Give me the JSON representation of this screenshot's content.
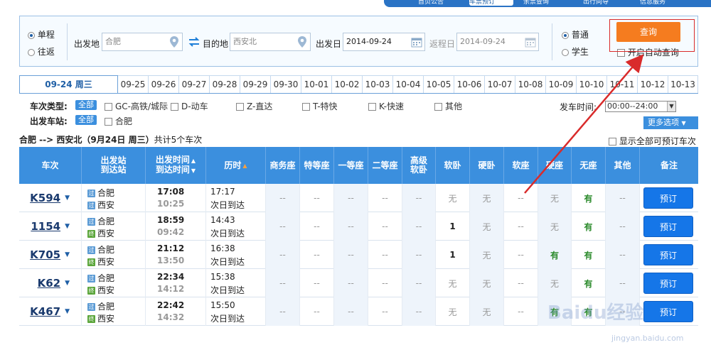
{
  "topnav": {
    "tabs": [
      {
        "label": "首页公告",
        "active": false
      },
      {
        "label": "车票预订",
        "active": true
      },
      {
        "label": "余票查询",
        "active": false
      },
      {
        "label": "出行向导",
        "active": false
      },
      {
        "label": "信息服务",
        "active": false
      }
    ]
  },
  "search": {
    "trip_one_way": "单程",
    "trip_round": "往返",
    "from_label": "出发地",
    "from_value": "合肥",
    "to_label": "目的地",
    "to_value": "西安北",
    "depart_label": "出发日",
    "depart_value": "2014-09-24",
    "return_label": "返程日",
    "return_value": "2014-09-24",
    "passenger_normal": "普通",
    "passenger_student": "学生",
    "query_button": "查询",
    "auto_query": "开启自动查询"
  },
  "dates": [
    "09-24 周三",
    "09-25",
    "09-26",
    "09-27",
    "09-28",
    "09-29",
    "09-30",
    "10-01",
    "10-02",
    "10-03",
    "10-04",
    "10-05",
    "10-06",
    "10-07",
    "10-08",
    "10-09",
    "10-10",
    "10-11",
    "10-12",
    "10-13"
  ],
  "filters": {
    "type_label": "车次类型:",
    "station_label": "出发车站:",
    "all_pill": "全部",
    "types": [
      "GC-高铁/城际",
      "D-动车",
      "Z-直达",
      "T-特快",
      "K-快速",
      "其他"
    ],
    "stations": [
      "合肥"
    ],
    "time_label": "发车时间:",
    "time_value": "00:00--24:00",
    "more_options": "更多选项"
  },
  "summary": {
    "route": "合肥 --> 西安北（9月24日  周三）",
    "count": "共计5个车次",
    "show_all": "显示全部可预订车次"
  },
  "table": {
    "headers": {
      "train": "车次",
      "stations_top": "出发站",
      "stations_bottom": "到达站",
      "times_top": "出发时间",
      "times_bottom": "到达时间",
      "duration": "历时",
      "business": "商务座",
      "special": "特等座",
      "first": "一等座",
      "second": "二等座",
      "premium_top": "高级",
      "premium_bottom": "软卧",
      "soft_sleeper": "软卧",
      "hard_sleeper": "硬卧",
      "soft_seat": "软座",
      "hard_seat": "硬座",
      "no_seat": "无座",
      "other": "其他",
      "remark": "备注"
    },
    "rows": [
      {
        "train": "K594",
        "from": "合肥",
        "to": "西安",
        "from_badge": "过",
        "to_badge": "过",
        "dep": "17:08",
        "arr": "10:25",
        "dur": "17:17",
        "dur_note": "次日到达",
        "seats": [
          "--",
          "--",
          "--",
          "--",
          "--",
          "无",
          "无",
          "--",
          "无",
          "有",
          "--"
        ],
        "book": "预订"
      },
      {
        "train": "1154",
        "from": "合肥",
        "to": "西安",
        "from_badge": "过",
        "to_badge": "终",
        "dep": "18:59",
        "arr": "09:42",
        "dur": "14:43",
        "dur_note": "次日到达",
        "seats": [
          "--",
          "--",
          "--",
          "--",
          "--",
          "1",
          "无",
          "--",
          "无",
          "有",
          "--"
        ],
        "book": "预订"
      },
      {
        "train": "K705",
        "from": "合肥",
        "to": "西安",
        "from_badge": "过",
        "to_badge": "终",
        "dep": "21:12",
        "arr": "13:50",
        "dur": "16:38",
        "dur_note": "次日到达",
        "seats": [
          "--",
          "--",
          "--",
          "--",
          "--",
          "1",
          "无",
          "--",
          "有",
          "有",
          "--"
        ],
        "book": "预订"
      },
      {
        "train": "K62",
        "from": "合肥",
        "to": "西安",
        "from_badge": "过",
        "to_badge": "终",
        "dep": "22:34",
        "arr": "14:12",
        "dur": "15:38",
        "dur_note": "次日到达",
        "seats": [
          "--",
          "--",
          "--",
          "--",
          "--",
          "无",
          "无",
          "--",
          "无",
          "有",
          "--"
        ],
        "book": "预订"
      },
      {
        "train": "K467",
        "from": "合肥",
        "to": "西安",
        "from_badge": "过",
        "to_badge": "终",
        "dep": "22:42",
        "arr": "14:32",
        "dur": "15:50",
        "dur_note": "次日到达",
        "seats": [
          "--",
          "--",
          "--",
          "--",
          "--",
          "无",
          "无",
          "--",
          "有",
          "有",
          "--"
        ],
        "book": "预订"
      }
    ]
  },
  "watermark": {
    "main": "Baidu经验",
    "url": "jingyan.baidu.com"
  },
  "colors": {
    "brand_blue": "#3b8fde",
    "query_orange": "#f57c1f",
    "available_green": "#2a8a2a",
    "annotation_red": "#d92b2b"
  }
}
